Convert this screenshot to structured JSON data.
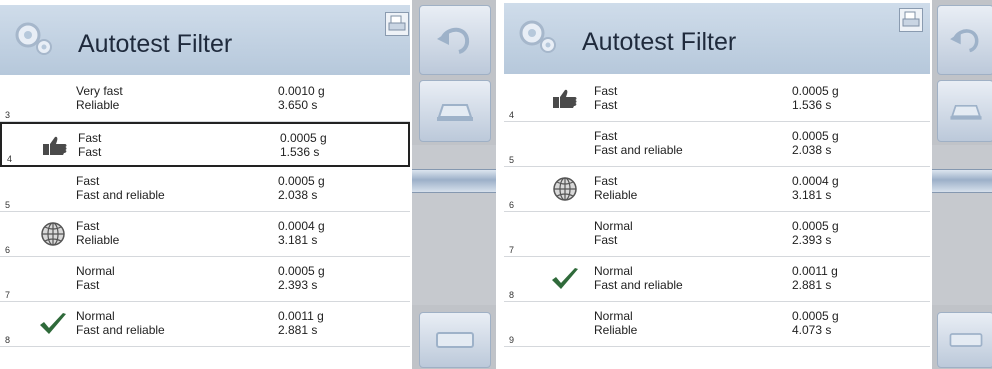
{
  "left_panel": {
    "title": "Autotest Filter",
    "rows": [
      {
        "index": "3",
        "icon": "none",
        "speed": "Very fast",
        "mode": "Reliable",
        "deviation": "0.0010 g",
        "time": "3.650 s",
        "selected": false
      },
      {
        "index": "4",
        "icon": "thumbs-up-icon",
        "speed": "Fast",
        "mode": "Fast",
        "deviation": "0.0005 g",
        "time": "1.536 s",
        "selected": true
      },
      {
        "index": "5",
        "icon": "none",
        "speed": "Fast",
        "mode": "Fast and reliable",
        "deviation": "0.0005 g",
        "time": "2.038 s",
        "selected": false
      },
      {
        "index": "6",
        "icon": "globe-icon",
        "speed": "Fast",
        "mode": "Reliable",
        "deviation": "0.0004 g",
        "time": "3.181 s",
        "selected": false
      },
      {
        "index": "7",
        "icon": "none",
        "speed": "Normal",
        "mode": "Fast",
        "deviation": "0.0005 g",
        "time": "2.393 s",
        "selected": false
      },
      {
        "index": "8",
        "icon": "check-icon",
        "speed": "Normal",
        "mode": "Fast and reliable",
        "deviation": "0.0011 g",
        "time": "2.881 s",
        "selected": false
      }
    ]
  },
  "right_panel": {
    "title": "Autotest Filter",
    "rows": [
      {
        "index": "4",
        "icon": "thumbs-up-icon",
        "speed": "Fast",
        "mode": "Fast",
        "deviation": "0.0005 g",
        "time": "1.536 s",
        "selected": false
      },
      {
        "index": "5",
        "icon": "none",
        "speed": "Fast",
        "mode": "Fast and reliable",
        "deviation": "0.0005 g",
        "time": "2.038 s",
        "selected": false
      },
      {
        "index": "6",
        "icon": "globe-icon",
        "speed": "Fast",
        "mode": "Reliable",
        "deviation": "0.0004 g",
        "time": "3.181 s",
        "selected": false
      },
      {
        "index": "7",
        "icon": "none",
        "speed": "Normal",
        "mode": "Fast",
        "deviation": "0.0005 g",
        "time": "2.393 s",
        "selected": false
      },
      {
        "index": "8",
        "icon": "check-icon",
        "speed": "Normal",
        "mode": "Fast and reliable",
        "deviation": "0.0011 g",
        "time": "2.881 s",
        "selected": false
      },
      {
        "index": "9",
        "icon": "none",
        "speed": "Normal",
        "mode": "Reliable",
        "deviation": "0.0005 g",
        "time": "4.073 s",
        "selected": false
      }
    ]
  },
  "icons": {
    "header": "gears-icon",
    "print": "print-icon",
    "back": "back-arrow-icon",
    "sidebar_top": "scale-icon",
    "sidebar_bottom": "keyboard-icon"
  },
  "colors": {
    "header": "#c4d3e4",
    "sidebar": "#c0c3c8",
    "check": "#2f6a3a",
    "selected_border": "#222222"
  }
}
